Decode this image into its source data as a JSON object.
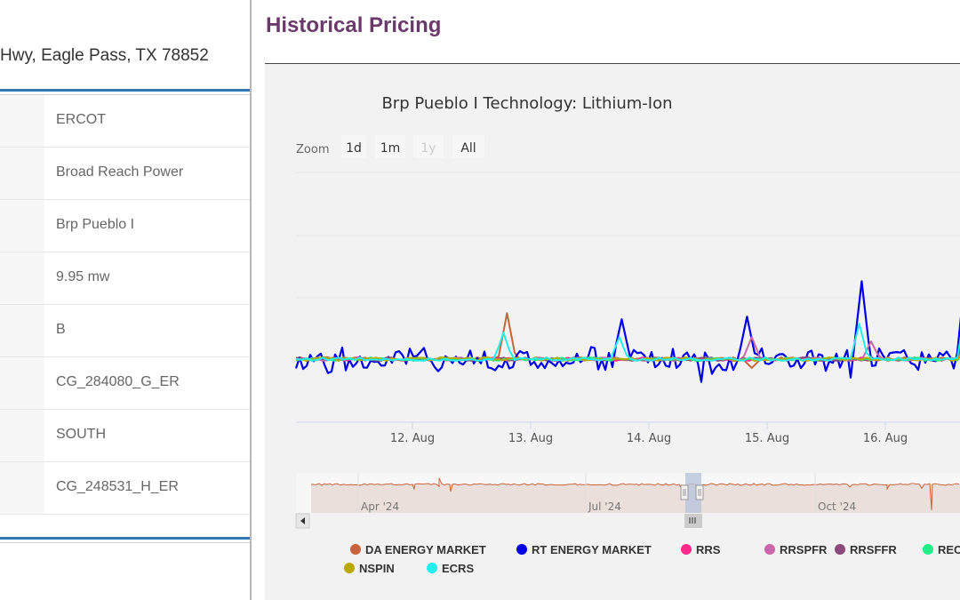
{
  "left_panel": {
    "address": "Hwy, Eagle Pass, TX 78852",
    "rows": [
      {
        "value": "ERCOT"
      },
      {
        "value": "Broad Reach Power"
      },
      {
        "value": "Brp Pueblo I"
      },
      {
        "value": "9.95 mw"
      },
      {
        "value": "B"
      },
      {
        "value": "CG_284080_G_ER"
      },
      {
        "value": "SOUTH"
      },
      {
        "value": "CG_248531_H_ER"
      }
    ]
  },
  "section": {
    "title": "Historical Pricing"
  },
  "zoom": {
    "label": "Zoom",
    "buttons": [
      {
        "label": "1d",
        "enabled": true
      },
      {
        "label": "1m",
        "enabled": true
      },
      {
        "label": "1y",
        "enabled": false
      },
      {
        "label": "All",
        "enabled": true
      }
    ]
  },
  "navigator": {
    "labels": [
      "Apr '24",
      "Jul '24",
      "Oct '24"
    ]
  },
  "chart_data": {
    "type": "line",
    "title": "Brp Pueblo I Technology: Lithium-Ion",
    "x_tick_labels": [
      "12. Aug",
      "13. Aug",
      "14. Aug",
      "15. Aug",
      "16. Aug"
    ],
    "legend_position": "bottom",
    "grid": true,
    "series": [
      {
        "name": "DA ENERGY MARKET",
        "color": "#c8643c",
        "spikes": [
          [
            0.8,
            52
          ],
          [
            2.87,
            -10
          ]
        ]
      },
      {
        "name": "RT ENERGY MARKET",
        "color": "#0000e6",
        "spikes": [
          [
            1.77,
            45
          ],
          [
            2.83,
            48
          ],
          [
            3.8,
            88
          ],
          [
            4.75,
            195
          ],
          [
            4.85,
            -35
          ]
        ]
      },
      {
        "name": "RRS",
        "color": "#ff2a8a",
        "spikes": [
          [
            4.77,
            70
          ]
        ]
      },
      {
        "name": "RRSPFR",
        "color": "#cc66aa",
        "spikes": [
          [
            2.87,
            25
          ],
          [
            3.88,
            20
          ],
          [
            4.82,
            90
          ]
        ]
      },
      {
        "name": "RRSFFR",
        "color": "#8b4a7a",
        "spikes": [
          [
            4.8,
            85
          ]
        ]
      },
      {
        "name": "REGUP",
        "color": "#22ee88",
        "spikes": [
          [
            4.78,
            30
          ]
        ]
      },
      {
        "name": "NSPIN",
        "color": "#b8a800",
        "spikes": [
          [
            4.7,
            15
          ]
        ]
      },
      {
        "name": "ECRS",
        "color": "#22eeee",
        "spikes": [
          [
            0.77,
            30
          ],
          [
            1.75,
            25
          ],
          [
            3.78,
            40
          ],
          [
            4.78,
            140
          ]
        ]
      }
    ],
    "legend_items": [
      "DA ENERGY MARKET",
      "RT ENERGY MARKET",
      "RRS",
      "RRSPFR",
      "RRSFFR",
      "REC",
      "NSPIN",
      "ECRS"
    ]
  },
  "colors": {
    "title_purple": "#6b3a6b",
    "rule_blue": "#3578b2"
  }
}
